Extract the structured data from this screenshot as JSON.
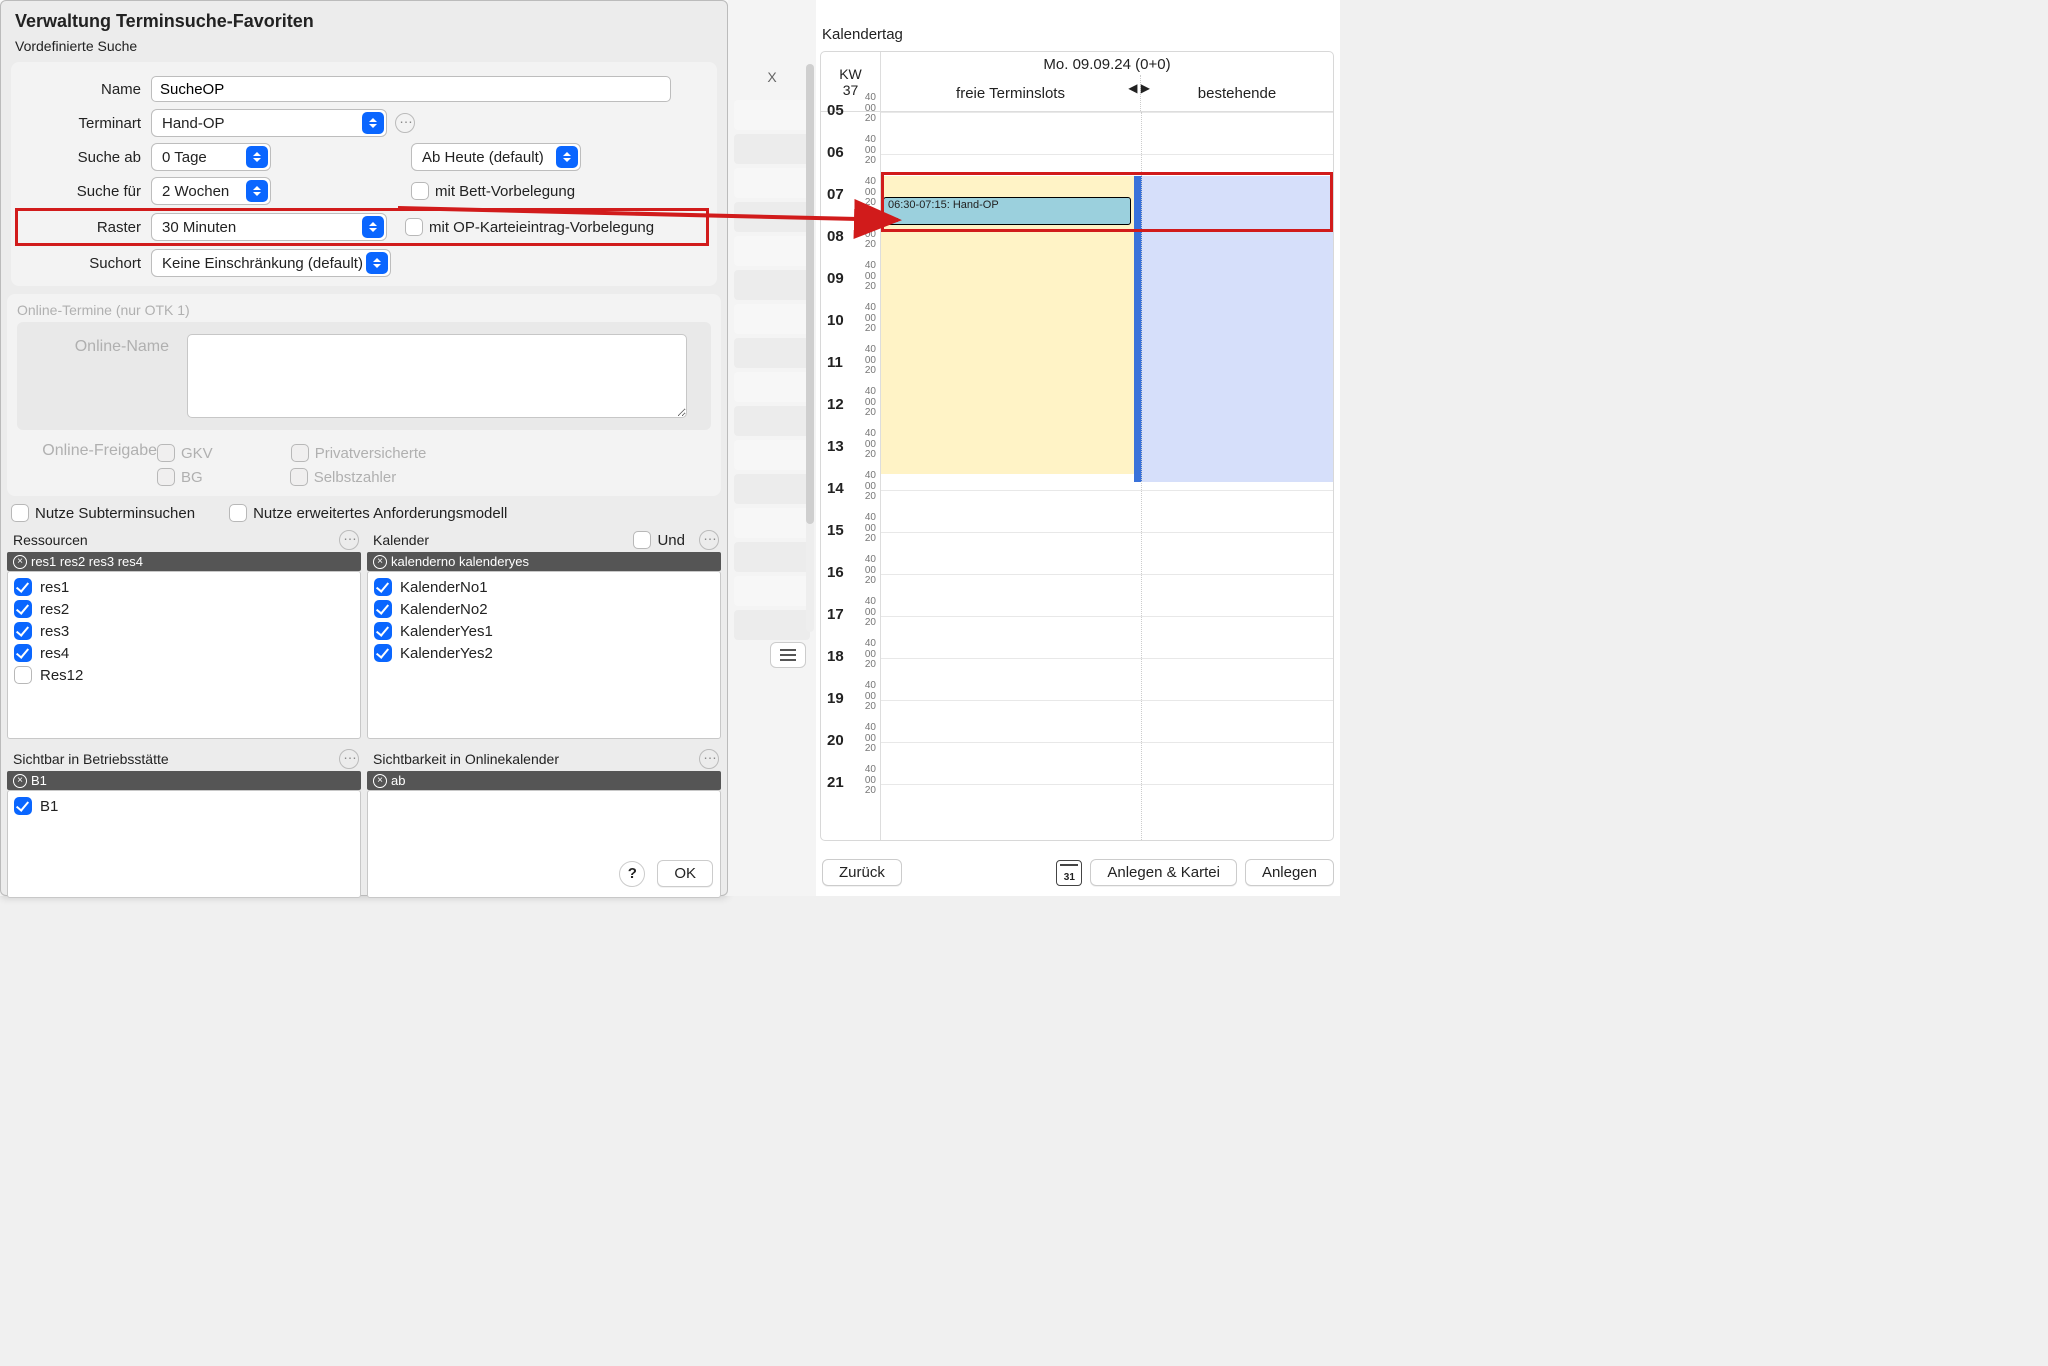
{
  "dialog": {
    "title": "Verwaltung Terminsuche-Favoriten",
    "predefined": "Vordefinierte Suche",
    "name_lbl": "Name",
    "name_val": "SucheOP",
    "terminart_lbl": "Terminart",
    "terminart_val": "Hand-OP",
    "sucheab_lbl": "Suche ab",
    "sucheab_val": "0 Tage",
    "abheute_val": "Ab Heute (default)",
    "suchefuer_lbl": "Suche für",
    "suchefuer_val": "2 Wochen",
    "bett_lbl": "mit Bett-Vorbelegung",
    "raster_lbl": "Raster",
    "raster_val": "30 Minuten",
    "opkartei_lbl": "mit OP-Karteieintrag-Vorbelegung",
    "suchort_lbl": "Suchort",
    "suchort_val": "Keine Einschränkung (default)",
    "online_section": "Online-Termine (nur OTK 1)",
    "online_name_lbl": "Online-Name",
    "online_freigabe_lbl": "Online-Freigabe",
    "gkv": "GKV",
    "privat": "Privatversicherte",
    "bg": "BG",
    "selbst": "Selbstzahler",
    "subtermin": "Nutze Subterminsuchen",
    "anforderung": "Nutze erweitertes Anforderungsmodell"
  },
  "ressourcen": {
    "title": "Ressourcen",
    "bar": "res1 res2 res3 res4",
    "items": [
      {
        "label": "res1",
        "checked": true
      },
      {
        "label": "res2",
        "checked": true
      },
      {
        "label": "res3",
        "checked": true
      },
      {
        "label": "res4",
        "checked": true
      },
      {
        "label": "Res12",
        "checked": false
      }
    ]
  },
  "kalender": {
    "title": "Kalender",
    "und": "Und",
    "bar": "kalenderno kalenderyes",
    "items": [
      {
        "label": "KalenderNo1",
        "checked": true
      },
      {
        "label": "KalenderNo2",
        "checked": true
      },
      {
        "label": "KalenderYes1",
        "checked": true
      },
      {
        "label": "KalenderYes2",
        "checked": true
      }
    ]
  },
  "sicht_bs": {
    "title": "Sichtbar in Betriebsstätte",
    "bar": "B1",
    "items": [
      {
        "label": "B1",
        "checked": true
      }
    ]
  },
  "sicht_online": {
    "title": "Sichtbarkeit in Onlinekalender",
    "bar": "ab"
  },
  "buttons": {
    "help": "?",
    "ok": "OK"
  },
  "mid": {
    "x": "X"
  },
  "calendar": {
    "section": "Kalendertag",
    "kw_lbl": "KW",
    "kw_num": "37",
    "date": "Mo. 09.09.24 (0+0)",
    "col_freie": "freie Terminslots",
    "col_best": "bestehende",
    "appt": "06:30-07:15: Hand-OP",
    "hours": [
      "05",
      "06",
      "07",
      "08",
      "09",
      "10",
      "11",
      "12",
      "13",
      "14",
      "15",
      "16",
      "17",
      "18",
      "19",
      "20",
      "21"
    ],
    "mins": [
      "40",
      "00",
      "20"
    ],
    "btn_back": "Zurück",
    "btn_anlegen_kartei": "Anlegen & Kartei",
    "btn_anlegen": "Anlegen"
  }
}
